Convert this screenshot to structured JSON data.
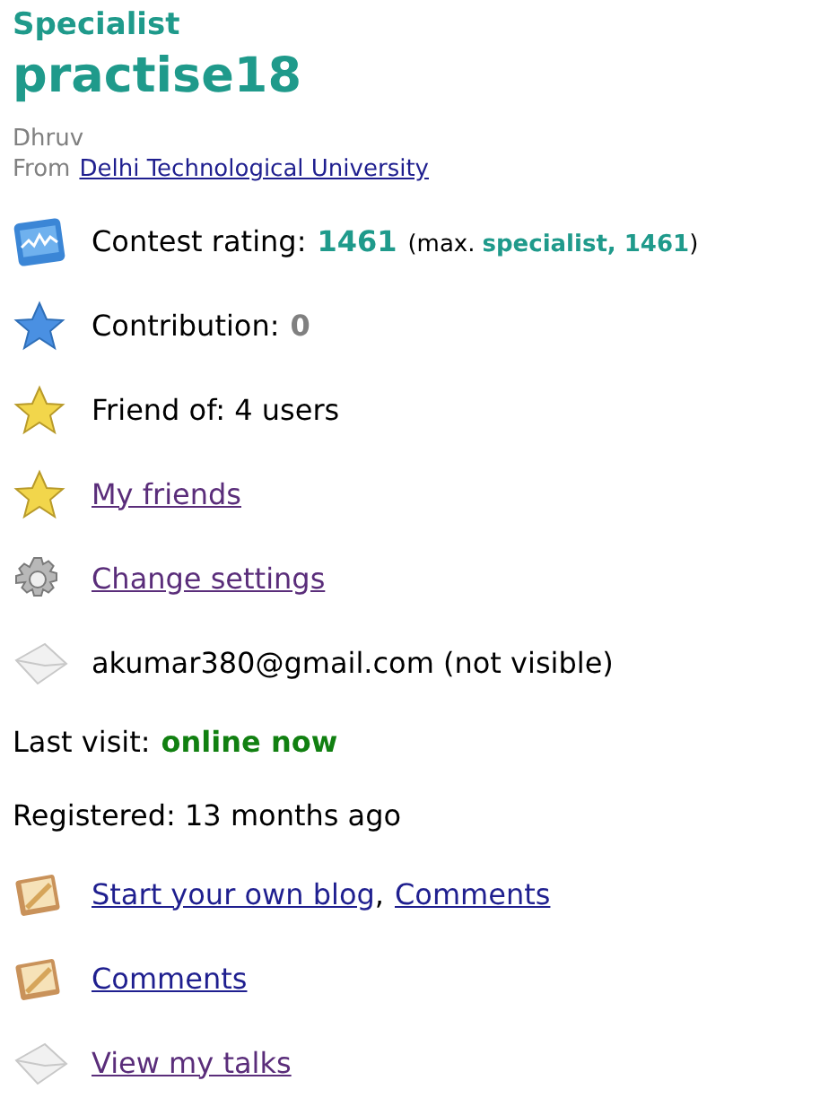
{
  "rank": "Specialist",
  "handle": "practise18",
  "name": "Dhruv",
  "from": {
    "label": "From",
    "link": {
      "text": "Delhi Technological University",
      "visited": false
    }
  },
  "items": [
    {
      "kind": "rating",
      "label": "Contest rating:",
      "value": "1461",
      "color": "#1f9a8b",
      "max_open": "(max.",
      "max_value": "specialist, 1461",
      "max_close": ")"
    },
    {
      "kind": "stat",
      "label": "Contribution:",
      "value": "0",
      "color": "#808080"
    },
    {
      "kind": "text",
      "text": "Friend of: 4 users"
    },
    {
      "kind": "links",
      "links": [
        {
          "text": "My friends",
          "visited": true
        }
      ]
    },
    {
      "kind": "links",
      "links": [
        {
          "text": "Change settings",
          "visited": true
        }
      ]
    },
    {
      "kind": "text",
      "text": "akumar380@gmail.com (not visible)"
    },
    {
      "kind": "stat",
      "label": "Last visit:",
      "value": "online now",
      "color": "#118011"
    },
    {
      "kind": "text",
      "text": "Registered: 13 months ago"
    },
    {
      "kind": "links",
      "separator": ",",
      "links": [
        {
          "text": "Start your own blog",
          "visited": false
        },
        {
          "text": "Comments",
          "visited": false
        }
      ]
    },
    {
      "kind": "links",
      "links": [
        {
          "text": "Comments",
          "visited": false
        }
      ]
    },
    {
      "kind": "links",
      "links": [
        {
          "text": "View my talks",
          "visited": true
        }
      ]
    }
  ]
}
